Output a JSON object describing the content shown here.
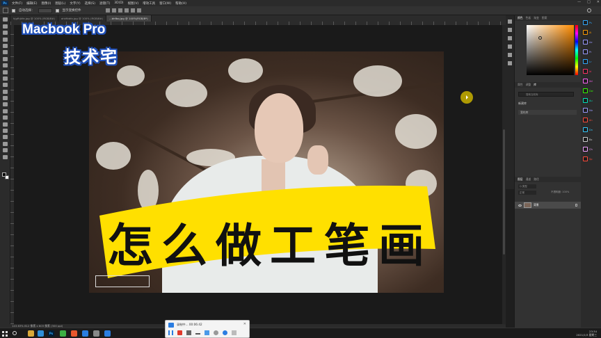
{
  "menu": {
    "logo": "Ps",
    "items": [
      "文件(F)",
      "编辑(E)",
      "图像(I)",
      "图层(L)",
      "文字(Y)",
      "选择(S)",
      "滤镜(T)",
      "3D(D)",
      "视图(V)",
      "增效工具",
      "窗口(W)",
      "帮助(H)"
    ],
    "window_controls": [
      "—",
      "□",
      "✕"
    ]
  },
  "options": {
    "auto_select": "自动选择：",
    "layer_select": "图层",
    "show_transform": "显示变换控件"
  },
  "doc_tabs": [
    {
      "label": "hjgfhjkfe.jpg @ 100% (RGB/8#)",
      "active": false
    },
    {
      "label": "ahkfbbfa.jpg @ 100% (RGB/8#)",
      "active": false
    },
    {
      "label": "...bhfbq.jpg @ 140%(RGB/8*)",
      "active": true
    }
  ],
  "watermark": {
    "title": "Macbook Pro",
    "subtitle": "技术宅"
  },
  "banner": {
    "text": "怎么做工笔画",
    "color": "#ffe000"
  },
  "status": {
    "text": "143.63%  812 像素 x 603 像素 (300 ppi)"
  },
  "panels": {
    "color_tabs": [
      "颜色",
      "色板",
      "渐变",
      "图案"
    ],
    "library_tabs": [
      "属性",
      "调整",
      "库"
    ],
    "library_search": "搜索当前库",
    "library_new": "新建库",
    "library_item": "我的库",
    "layers_tabs": [
      "图层",
      "通道",
      "路径"
    ],
    "layers_filter": "Q 类型",
    "layers_blend": "正常",
    "layers_opacity": "不透明度: 100%",
    "layer_name": "背景"
  },
  "app_strip": [
    {
      "label": "Ps",
      "color": "#31a8ff"
    },
    {
      "label": "Ai",
      "color": "#ff9a00"
    },
    {
      "label": "Ae",
      "color": "#9999ff"
    },
    {
      "label": "Pr",
      "color": "#9999ff"
    },
    {
      "label": "Lr",
      "color": "#31a8ff"
    },
    {
      "label": "Id",
      "color": "#ff3366"
    },
    {
      "label": "Xd",
      "color": "#ff61f6"
    },
    {
      "label": "Dw",
      "color": "#35fa00"
    },
    {
      "label": "Au",
      "color": "#00e4bb"
    },
    {
      "label": "Me",
      "color": "#9999ff"
    },
    {
      "label": "An",
      "color": "#ff4b3b"
    },
    {
      "label": "Dn",
      "color": "#33ccff"
    },
    {
      "label": "Bx",
      "color": "#cccccc"
    },
    {
      "label": "Ch",
      "color": "#f0a0ff"
    },
    {
      "label": "Sp",
      "color": "#ff4b3b"
    }
  ],
  "recorder": {
    "status": "录制中... 00:06:42",
    "close": "✕"
  },
  "taskbar": {
    "time": "23:34",
    "date": "2021/1/3 星期三"
  }
}
